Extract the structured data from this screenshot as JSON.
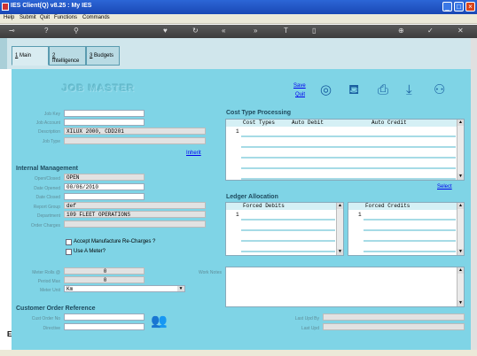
{
  "window": {
    "title": "IES Client(Q) v8.25 : My IES"
  },
  "menu": {
    "items": [
      "Help",
      "Submit",
      "Quit",
      "Functions",
      "Commands"
    ]
  },
  "toolbar": {
    "icons": [
      "key-icon",
      "help-icon",
      "search-icon",
      "heart-icon",
      "refresh-icon",
      "rewind-icon",
      "forward-icon",
      "text-icon",
      "page-icon",
      "add-icon",
      "check-icon",
      "close-icon"
    ]
  },
  "tabs": [
    {
      "num": "1",
      "label": "Main"
    },
    {
      "num": "2",
      "label": "Intelligence"
    },
    {
      "num": "3",
      "label": "Budgets"
    }
  ],
  "page": {
    "title": "JOB MASTER",
    "save": "Save",
    "quit": "Quit"
  },
  "job": {
    "key_label": "Job Key",
    "key_value": "",
    "account_label": "Job Account",
    "account_value": "",
    "description_label": "Description",
    "description_value": "XILUX 2000, CDD201",
    "type_label": "Job Type",
    "type_value": "",
    "inherit": "Inherit"
  },
  "internal": {
    "title": "Internal Management",
    "open_closed_label": "Open/Closed",
    "open_closed_value": "OPEN",
    "date_opened_label": "Date Opened",
    "date_opened_value": "00/06/2010",
    "date_closed_label": "Date Closed",
    "date_closed_value": "",
    "report_group_label": "Report Group",
    "report_group_value": "def",
    "department_label": "Department",
    "department_value": "109 FLEET OPERATIONS",
    "order_charges_label": "Order Charges",
    "order_charges_value": "",
    "accept_label": "Accept Manufacture Re-Charges ?",
    "use_meter_label": "Use A Meter?"
  },
  "meter": {
    "rolls_label": "Meter Rolls @",
    "rolls_value": "0",
    "period_label": "Period Max",
    "period_value": "0",
    "unit_label": "Meter Unit",
    "unit_value": "Km"
  },
  "cost_type": {
    "title": "Cost Type Processing",
    "headers": [
      "Cost Types",
      "Auto Debit",
      "Auto Credit"
    ],
    "row_number": "1",
    "select": "Select"
  },
  "ledger": {
    "title": "Ledger Allocation",
    "debit_header": "Forced Debits",
    "credit_header": "Forced Credits",
    "row_number": "1"
  },
  "notes": {
    "label": "Work Notes"
  },
  "customer": {
    "title": "Customer Order Reference",
    "order_label": "Cust Order No",
    "order_value": "",
    "directive_label": "Directive",
    "directive_value": ""
  },
  "audit": {
    "last_upd_by_label": "Last Upd By",
    "last_upd_by_value": "",
    "last_upd_label": "Last Upd",
    "last_upd_value": ""
  }
}
